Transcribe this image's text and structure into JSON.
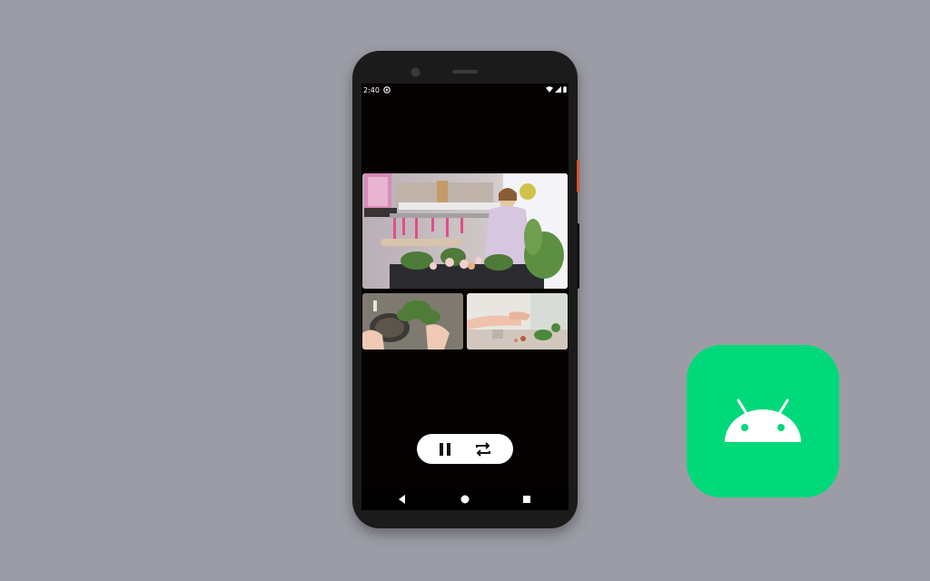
{
  "status_bar": {
    "time": "2:40",
    "notification_icon": "app-notification-icon",
    "icons": [
      "wifi-icon",
      "cell-signal-icon",
      "battery-icon"
    ]
  },
  "videos": [
    {
      "name": "florist-arranging-flowers",
      "role": "main"
    },
    {
      "name": "hands-potting-plant",
      "role": "thumbnail"
    },
    {
      "name": "hands-over-moss-table",
      "role": "thumbnail"
    }
  ],
  "controls": {
    "pause_icon": "pause-icon",
    "repeat_icon": "repeat-icon"
  },
  "nav_bar": {
    "icons": [
      "back-icon",
      "home-icon",
      "recents-icon"
    ]
  },
  "colors": {
    "background": "#9c9ca6",
    "screen": "#070202",
    "android_tile": "#00d97a",
    "controls_pill": "#ffffff"
  },
  "logo": "android-logo"
}
